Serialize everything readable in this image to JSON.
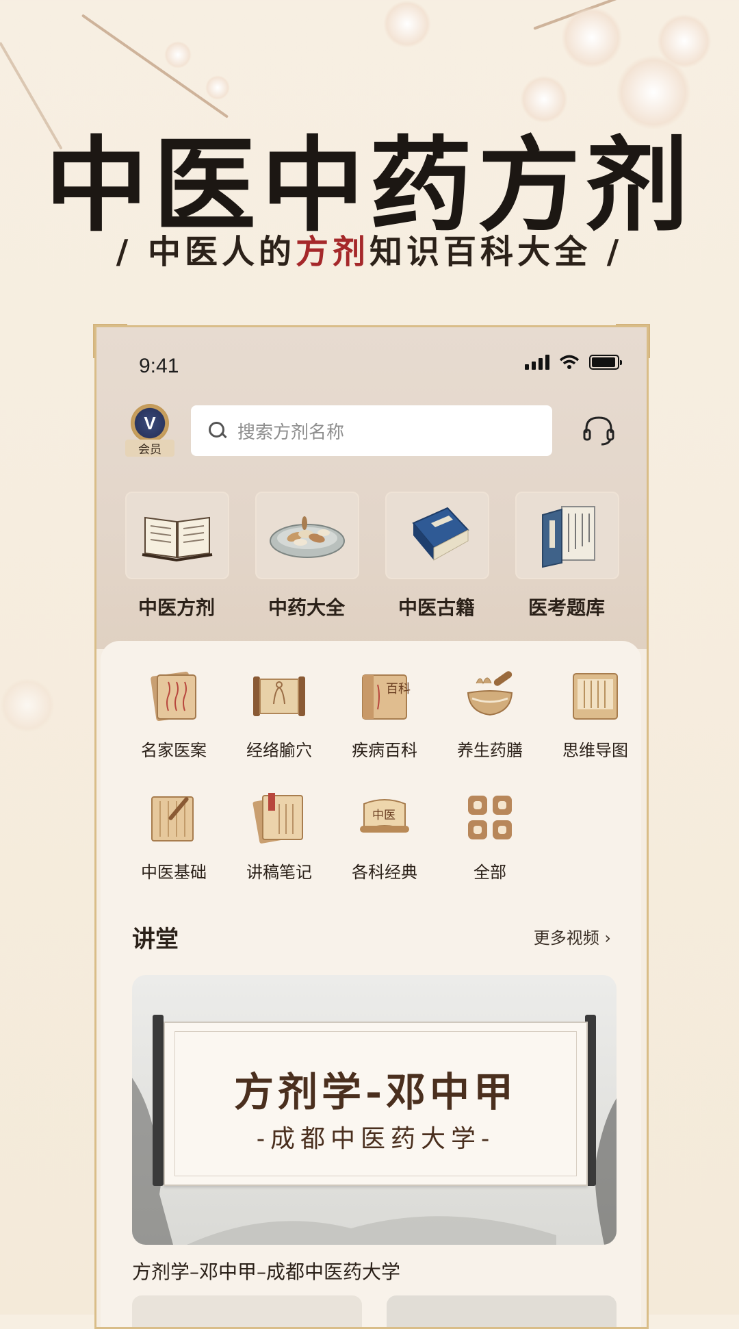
{
  "promo": {
    "title": "中医中药方剂",
    "subtitle_pre": "/ 中医人的",
    "subtitle_highlight": "方剂",
    "subtitle_post": "知识百科大全 /"
  },
  "status_bar": {
    "time": "9:41",
    "icons": [
      "signal-icon",
      "wifi-icon",
      "battery-icon"
    ]
  },
  "header": {
    "vip_badge_letter": "V",
    "vip_label": "会员",
    "search_placeholder": "搜索方剂名称",
    "support_icon": "headset-icon"
  },
  "features": [
    {
      "label": "中医方剂",
      "icon": "open-book-icon"
    },
    {
      "label": "中药大全",
      "icon": "herb-bowl-icon"
    },
    {
      "label": "中医古籍",
      "icon": "ancient-book-icon"
    },
    {
      "label": "医考题库",
      "icon": "scroll-book-icon"
    }
  ],
  "categories": [
    {
      "label": "名家医案",
      "icon": "case-record-icon"
    },
    {
      "label": "经络腧穴",
      "icon": "meridian-scroll-icon"
    },
    {
      "label": "疾病百科",
      "icon": "encyclopedia-icon",
      "icon_text": "百科"
    },
    {
      "label": "养生药膳",
      "icon": "mortar-pestle-icon"
    },
    {
      "label": "思维导图",
      "icon": "mind-map-icon"
    },
    {
      "label": "中医基础",
      "icon": "brush-board-icon"
    },
    {
      "label": "讲稿笔记",
      "icon": "notes-icon"
    },
    {
      "label": "各科经典",
      "icon": "classic-scroll-icon",
      "icon_text": "中医"
    },
    {
      "label": "全部",
      "icon": "all-grid-icon"
    }
  ],
  "lecture": {
    "section_title": "讲堂",
    "more_label": "更多视频",
    "banner_title": "方剂学-邓中甲",
    "banner_subtitle": "-成都中医药大学-",
    "video_title": "方剂学–邓中甲–成都中医药大学"
  },
  "colors": {
    "accent_red": "#a5282a",
    "gold_frame": "#d9bd88",
    "background": "#f7efe2"
  }
}
